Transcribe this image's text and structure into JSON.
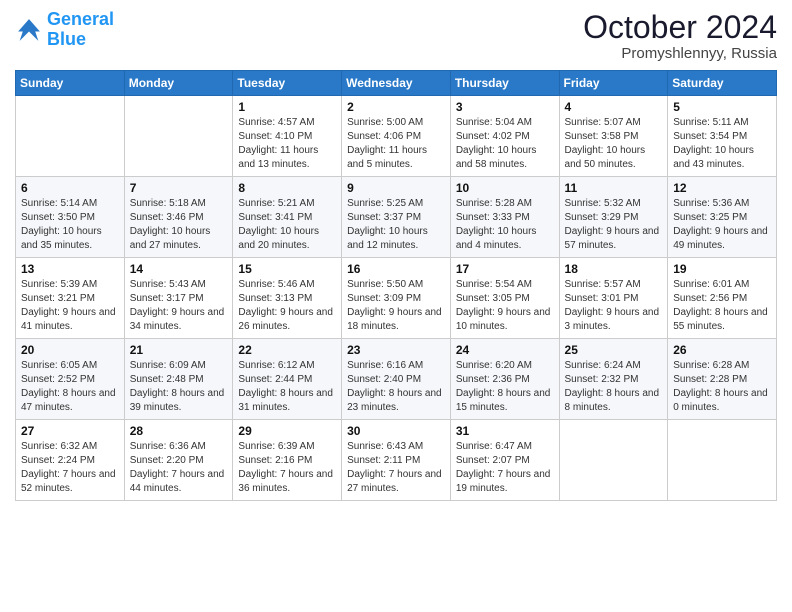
{
  "logo": {
    "text1": "General",
    "text2": "Blue"
  },
  "title": "October 2024",
  "location": "Promyshlennyy, Russia",
  "days_header": [
    "Sunday",
    "Monday",
    "Tuesday",
    "Wednesday",
    "Thursday",
    "Friday",
    "Saturday"
  ],
  "weeks": [
    [
      {
        "day": "",
        "sunrise": "",
        "sunset": "",
        "daylight": ""
      },
      {
        "day": "",
        "sunrise": "",
        "sunset": "",
        "daylight": ""
      },
      {
        "day": "1",
        "sunrise": "Sunrise: 4:57 AM",
        "sunset": "Sunset: 4:10 PM",
        "daylight": "Daylight: 11 hours and 13 minutes."
      },
      {
        "day": "2",
        "sunrise": "Sunrise: 5:00 AM",
        "sunset": "Sunset: 4:06 PM",
        "daylight": "Daylight: 11 hours and 5 minutes."
      },
      {
        "day": "3",
        "sunrise": "Sunrise: 5:04 AM",
        "sunset": "Sunset: 4:02 PM",
        "daylight": "Daylight: 10 hours and 58 minutes."
      },
      {
        "day": "4",
        "sunrise": "Sunrise: 5:07 AM",
        "sunset": "Sunset: 3:58 PM",
        "daylight": "Daylight: 10 hours and 50 minutes."
      },
      {
        "day": "5",
        "sunrise": "Sunrise: 5:11 AM",
        "sunset": "Sunset: 3:54 PM",
        "daylight": "Daylight: 10 hours and 43 minutes."
      }
    ],
    [
      {
        "day": "6",
        "sunrise": "Sunrise: 5:14 AM",
        "sunset": "Sunset: 3:50 PM",
        "daylight": "Daylight: 10 hours and 35 minutes."
      },
      {
        "day": "7",
        "sunrise": "Sunrise: 5:18 AM",
        "sunset": "Sunset: 3:46 PM",
        "daylight": "Daylight: 10 hours and 27 minutes."
      },
      {
        "day": "8",
        "sunrise": "Sunrise: 5:21 AM",
        "sunset": "Sunset: 3:41 PM",
        "daylight": "Daylight: 10 hours and 20 minutes."
      },
      {
        "day": "9",
        "sunrise": "Sunrise: 5:25 AM",
        "sunset": "Sunset: 3:37 PM",
        "daylight": "Daylight: 10 hours and 12 minutes."
      },
      {
        "day": "10",
        "sunrise": "Sunrise: 5:28 AM",
        "sunset": "Sunset: 3:33 PM",
        "daylight": "Daylight: 10 hours and 4 minutes."
      },
      {
        "day": "11",
        "sunrise": "Sunrise: 5:32 AM",
        "sunset": "Sunset: 3:29 PM",
        "daylight": "Daylight: 9 hours and 57 minutes."
      },
      {
        "day": "12",
        "sunrise": "Sunrise: 5:36 AM",
        "sunset": "Sunset: 3:25 PM",
        "daylight": "Daylight: 9 hours and 49 minutes."
      }
    ],
    [
      {
        "day": "13",
        "sunrise": "Sunrise: 5:39 AM",
        "sunset": "Sunset: 3:21 PM",
        "daylight": "Daylight: 9 hours and 41 minutes."
      },
      {
        "day": "14",
        "sunrise": "Sunrise: 5:43 AM",
        "sunset": "Sunset: 3:17 PM",
        "daylight": "Daylight: 9 hours and 34 minutes."
      },
      {
        "day": "15",
        "sunrise": "Sunrise: 5:46 AM",
        "sunset": "Sunset: 3:13 PM",
        "daylight": "Daylight: 9 hours and 26 minutes."
      },
      {
        "day": "16",
        "sunrise": "Sunrise: 5:50 AM",
        "sunset": "Sunset: 3:09 PM",
        "daylight": "Daylight: 9 hours and 18 minutes."
      },
      {
        "day": "17",
        "sunrise": "Sunrise: 5:54 AM",
        "sunset": "Sunset: 3:05 PM",
        "daylight": "Daylight: 9 hours and 10 minutes."
      },
      {
        "day": "18",
        "sunrise": "Sunrise: 5:57 AM",
        "sunset": "Sunset: 3:01 PM",
        "daylight": "Daylight: 9 hours and 3 minutes."
      },
      {
        "day": "19",
        "sunrise": "Sunrise: 6:01 AM",
        "sunset": "Sunset: 2:56 PM",
        "daylight": "Daylight: 8 hours and 55 minutes."
      }
    ],
    [
      {
        "day": "20",
        "sunrise": "Sunrise: 6:05 AM",
        "sunset": "Sunset: 2:52 PM",
        "daylight": "Daylight: 8 hours and 47 minutes."
      },
      {
        "day": "21",
        "sunrise": "Sunrise: 6:09 AM",
        "sunset": "Sunset: 2:48 PM",
        "daylight": "Daylight: 8 hours and 39 minutes."
      },
      {
        "day": "22",
        "sunrise": "Sunrise: 6:12 AM",
        "sunset": "Sunset: 2:44 PM",
        "daylight": "Daylight: 8 hours and 31 minutes."
      },
      {
        "day": "23",
        "sunrise": "Sunrise: 6:16 AM",
        "sunset": "Sunset: 2:40 PM",
        "daylight": "Daylight: 8 hours and 23 minutes."
      },
      {
        "day": "24",
        "sunrise": "Sunrise: 6:20 AM",
        "sunset": "Sunset: 2:36 PM",
        "daylight": "Daylight: 8 hours and 15 minutes."
      },
      {
        "day": "25",
        "sunrise": "Sunrise: 6:24 AM",
        "sunset": "Sunset: 2:32 PM",
        "daylight": "Daylight: 8 hours and 8 minutes."
      },
      {
        "day": "26",
        "sunrise": "Sunrise: 6:28 AM",
        "sunset": "Sunset: 2:28 PM",
        "daylight": "Daylight: 8 hours and 0 minutes."
      }
    ],
    [
      {
        "day": "27",
        "sunrise": "Sunrise: 6:32 AM",
        "sunset": "Sunset: 2:24 PM",
        "daylight": "Daylight: 7 hours and 52 minutes."
      },
      {
        "day": "28",
        "sunrise": "Sunrise: 6:36 AM",
        "sunset": "Sunset: 2:20 PM",
        "daylight": "Daylight: 7 hours and 44 minutes."
      },
      {
        "day": "29",
        "sunrise": "Sunrise: 6:39 AM",
        "sunset": "Sunset: 2:16 PM",
        "daylight": "Daylight: 7 hours and 36 minutes."
      },
      {
        "day": "30",
        "sunrise": "Sunrise: 6:43 AM",
        "sunset": "Sunset: 2:11 PM",
        "daylight": "Daylight: 7 hours and 27 minutes."
      },
      {
        "day": "31",
        "sunrise": "Sunrise: 6:47 AM",
        "sunset": "Sunset: 2:07 PM",
        "daylight": "Daylight: 7 hours and 19 minutes."
      },
      {
        "day": "",
        "sunrise": "",
        "sunset": "",
        "daylight": ""
      },
      {
        "day": "",
        "sunrise": "",
        "sunset": "",
        "daylight": ""
      }
    ]
  ]
}
